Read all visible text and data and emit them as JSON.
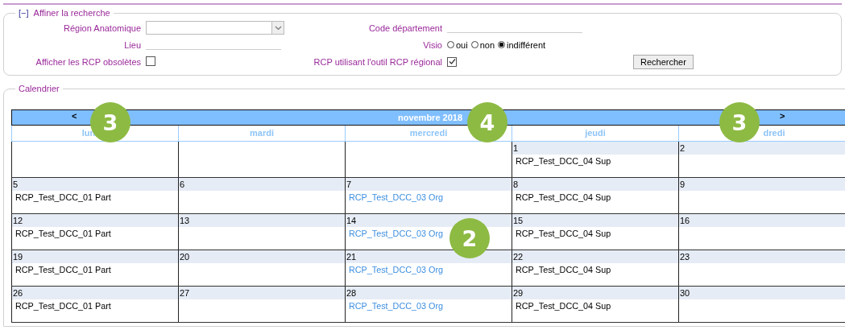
{
  "filter": {
    "toggle": "[−]",
    "title": "Affiner la recherche",
    "region": {
      "label": "Région Anatomique"
    },
    "code": {
      "label": "Code département"
    },
    "lieu": {
      "label": "Lieu"
    },
    "visio": {
      "label": "Visio",
      "options": [
        {
          "label": "oui",
          "selected": false
        },
        {
          "label": "non",
          "selected": false
        },
        {
          "label": "indifférent",
          "selected": true
        }
      ]
    },
    "obsolete": {
      "label": "Afficher les RCP obsolètes",
      "checked": false
    },
    "regional": {
      "label": "RCP utilisant l'outil RCP régional",
      "checked": true
    },
    "search_button": "Rechercher"
  },
  "calendar": {
    "title": "Calendrier",
    "prev": "<",
    "month": "novembre 2018",
    "next": ">",
    "days": [
      "lun",
      "mardi",
      "mercredi",
      "jeudi",
      "dredi"
    ],
    "weeks": [
      [
        {
          "kind": "outside"
        },
        {
          "kind": "outside"
        },
        {
          "kind": "outside"
        },
        {
          "date": "1",
          "events": [
            {
              "text": "RCP_Test_DCC_04 Sup",
              "kind": "plain"
            }
          ]
        },
        {
          "date": "2"
        }
      ],
      [
        {
          "date": "5",
          "events": [
            {
              "text": "RCP_Test_DCC_01 Part",
              "kind": "plain"
            }
          ]
        },
        {
          "date": "6"
        },
        {
          "date": "7",
          "events": [
            {
              "text": "RCP_Test_DCC_03 Org",
              "kind": "link"
            }
          ]
        },
        {
          "date": "8",
          "events": [
            {
              "text": "RCP_Test_DCC_04 Sup",
              "kind": "plain"
            }
          ]
        },
        {
          "date": "9"
        }
      ],
      [
        {
          "date": "12",
          "events": [
            {
              "text": "RCP_Test_DCC_01 Part",
              "kind": "plain"
            }
          ]
        },
        {
          "date": "13"
        },
        {
          "date": "14",
          "events": [
            {
              "text": "RCP_Test_DCC_03 Org",
              "kind": "link"
            }
          ]
        },
        {
          "date": "15",
          "events": [
            {
              "text": "RCP_Test_DCC_04 Sup",
              "kind": "plain"
            }
          ]
        },
        {
          "date": "16"
        }
      ],
      [
        {
          "date": "19",
          "events": [
            {
              "text": "RCP_Test_DCC_01 Part",
              "kind": "plain"
            }
          ]
        },
        {
          "date": "20"
        },
        {
          "date": "21",
          "events": [
            {
              "text": "RCP_Test_DCC_03 Org",
              "kind": "link"
            }
          ]
        },
        {
          "date": "22",
          "events": [
            {
              "text": "RCP_Test_DCC_04 Sup",
              "kind": "plain"
            }
          ]
        },
        {
          "date": "23"
        }
      ],
      [
        {
          "date": "26",
          "events": [
            {
              "text": "RCP_Test_DCC_01 Part",
              "kind": "plain"
            }
          ]
        },
        {
          "date": "27"
        },
        {
          "date": "28",
          "events": [
            {
              "text": "RCP_Test_DCC_03 Org",
              "kind": "link"
            }
          ]
        },
        {
          "date": "29",
          "events": [
            {
              "text": "RCP_Test_DCC_04 Sup",
              "kind": "plain"
            }
          ]
        },
        {
          "date": "30"
        }
      ]
    ]
  },
  "callouts": [
    {
      "label": "3"
    },
    {
      "label": "4"
    },
    {
      "label": "3"
    },
    {
      "label": "2"
    }
  ]
}
